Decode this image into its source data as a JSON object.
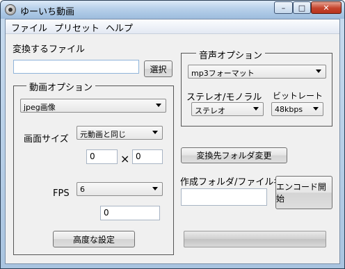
{
  "window": {
    "title": "ゆーいち動画",
    "icon": "app-disc-icon",
    "min_symbol": "–",
    "max_symbol": "□",
    "close_symbol": "✕"
  },
  "menu": [
    "ファイル",
    "プリセット",
    "ヘルプ"
  ],
  "file_section": {
    "label": "変換するファイル",
    "input_value": "",
    "select_button": "選択"
  },
  "video_options": {
    "title": "動画オプション",
    "format_value": "jpeg画像",
    "screen_size_label": "画面サイズ",
    "screen_size_value": "元動画と同じ",
    "width_value": "0",
    "times_symbol": "×",
    "height_value": "0",
    "fps_label": "FPS",
    "fps_value": "6",
    "fps_custom_value": "0",
    "advanced_button": "高度な設定"
  },
  "audio_options": {
    "title": "音声オプション",
    "format_value": "mp3フォーマット",
    "channel_label": "ステレオ/モノラル",
    "channel_value": "ステレオ",
    "bitrate_label": "ビットレート",
    "bitrate_value": "48kbps"
  },
  "output": {
    "change_folder_button": "変換先フォルダ変更",
    "folder_label": "作成フォルダ/ファイル名",
    "folder_value": "",
    "encode_button": "エンコード開始",
    "progress_fraction": 0
  }
}
